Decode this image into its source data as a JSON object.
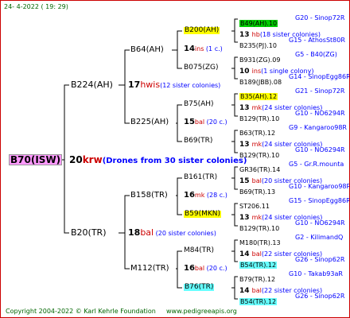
{
  "header": {
    "date": "24-  4-2022  ( 19:  29)"
  },
  "colors": {
    "root_bg": "#ff99ff",
    "yellow_hl": "#ffff00",
    "green_hl": "#00cc00",
    "cyan_hl": "#66ffff",
    "breeder_red": "#cc0000",
    "note_blue": "#0000ff",
    "footer_green": "#006600",
    "border_red": "#cc0000"
  },
  "root": {
    "id": "B70(ISW)",
    "year": "20",
    "breeder": "krw",
    "note": "(Drones from 30 sister colonies)"
  },
  "l1": [
    {
      "id": "B224(AH)",
      "year": "17",
      "breeder": "hwis",
      "note": "(12 sister colonies)"
    },
    {
      "id": "B20(TR)",
      "year": "18",
      "breeder": "bal",
      "note": "  (20 sister colonies)"
    }
  ],
  "l2": [
    {
      "id": "B64(AH)",
      "year": "14",
      "breeder": "ins",
      "note": "  (1 c.)"
    },
    {
      "id": "B225(AH)",
      "year": "15",
      "breeder": "bal",
      "note": "  (20 c.)"
    },
    {
      "id": "B158(TR)",
      "year": "16",
      "breeder": "mk",
      "note": "  (28 c.)"
    },
    {
      "id": "M112(TR)",
      "year": "16",
      "breeder": "bal",
      "note": "  (20 c.)"
    }
  ],
  "l3": [
    {
      "id": "B200(AH)"
    },
    {
      "id": "B075(ZG)"
    },
    {
      "id": "B75(AH)"
    },
    {
      "id": "B69(TR)"
    },
    {
      "id": "B161(TR)"
    },
    {
      "id": "B59(MKN)"
    },
    {
      "id": "M84(TR)"
    },
    {
      "id": "B76(TR)"
    }
  ],
  "l4": [
    {
      "kind": "queen",
      "id": "B49(AH).10",
      "hl": "green",
      "ref": "G20 - Sinop72R"
    },
    {
      "kind": "mating",
      "year": "13",
      "breeder": "hb",
      "note": "(18 sister colonies)"
    },
    {
      "kind": "queen",
      "id": "B235(PJ).10",
      "ref": "G15 - AthosSt80R"
    },
    {
      "kind": "queen",
      "id": "B931(ZG).09",
      "ref": "G5 - B40(ZG)"
    },
    {
      "kind": "mating",
      "year": "10",
      "breeder": "ins",
      "note": "(1 single colony)"
    },
    {
      "kind": "queen",
      "id": "B189(JBB).08",
      "ref": "G14 - SinopEgg86R"
    },
    {
      "kind": "queen",
      "id": "B35(AH).12",
      "hl": "yellow",
      "ref": "G21 - Sinop72R"
    },
    {
      "kind": "mating",
      "year": "13",
      "breeder": "mk",
      "note": "(24 sister colonies)"
    },
    {
      "kind": "queen",
      "id": "B129(TR).10",
      "ref": "G10 - NO6294R"
    },
    {
      "kind": "queen",
      "id": "B63(TR).12",
      "ref": "G9 - Kangaroo98R"
    },
    {
      "kind": "mating",
      "year": "13",
      "breeder": "mk",
      "note": "(24 sister colonies)"
    },
    {
      "kind": "queen",
      "id": "B129(TR).10",
      "ref": "G10 - NO6294R"
    },
    {
      "kind": "queen",
      "id": "GR36(TR).14",
      "ref": "G5 - Gr.R.mounta"
    },
    {
      "kind": "mating",
      "year": "15",
      "breeder": "bal",
      "note": "(20 sister colonies)"
    },
    {
      "kind": "queen",
      "id": "B69(TR).13",
      "ref": "G10 - Kangaroo98R"
    },
    {
      "kind": "queen",
      "id": "ST206.11",
      "ref": "G15 - SinopEgg86R"
    },
    {
      "kind": "mating",
      "year": "13",
      "breeder": "mk",
      "note": "(24 sister colonies)"
    },
    {
      "kind": "queen",
      "id": "B129(TR).10",
      "ref": "G10 - NO6294R"
    },
    {
      "kind": "queen",
      "id": "M180(TR).13",
      "ref": "G2 - KilimandQ"
    },
    {
      "kind": "mating",
      "year": "14",
      "breeder": "bal",
      "note": "(22 sister colonies)"
    },
    {
      "kind": "queen",
      "id": "B54(TR).12",
      "hl": "cyan",
      "ref": "G26 - Sinop62R"
    },
    {
      "kind": "queen",
      "id": "B79(TR).12",
      "ref": "G10 - Takab93aR"
    },
    {
      "kind": "mating",
      "year": "14",
      "breeder": "bal",
      "note": "(22 sister colonies)"
    },
    {
      "kind": "queen",
      "id": "B54(TR).12",
      "hl": "cyan",
      "ref": "G26 - Sinop62R"
    }
  ],
  "footer": {
    "copyright": "Copyright 2004-2022 © Karl Kehrle Foundation",
    "url": "www.pedigreeapis.org"
  }
}
